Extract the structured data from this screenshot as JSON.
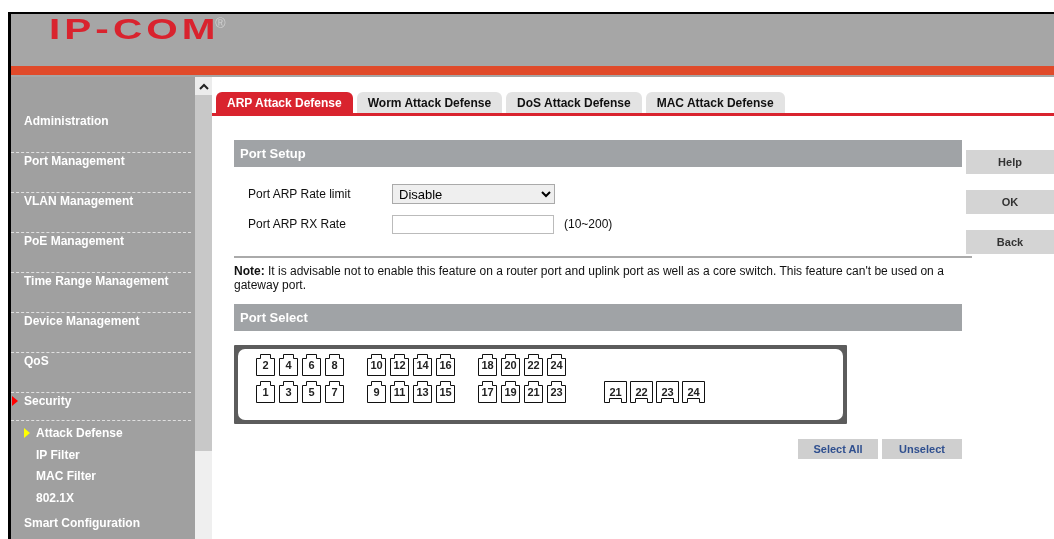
{
  "header": {
    "logo": "IP-COM",
    "logo_mark": "®"
  },
  "sidebar": {
    "items": [
      {
        "label": "Administration",
        "selected": false
      },
      {
        "label": "Port Management",
        "selected": false
      },
      {
        "label": "VLAN Management",
        "selected": false
      },
      {
        "label": "PoE Management",
        "selected": false
      },
      {
        "label": "Time Range Management",
        "selected": false
      },
      {
        "label": "Device Management",
        "selected": false
      },
      {
        "label": "QoS",
        "selected": false
      },
      {
        "label": "Security",
        "selected": true,
        "children": [
          {
            "label": "Attack Defense",
            "selected": true
          },
          {
            "label": "IP Filter",
            "selected": false
          },
          {
            "label": "MAC Filter",
            "selected": false
          },
          {
            "label": "802.1X",
            "selected": false
          }
        ]
      },
      {
        "label": "Smart Configuration",
        "selected": false
      }
    ]
  },
  "tabs": [
    {
      "label": "ARP Attack Defense",
      "selected": true
    },
    {
      "label": "Worm Attack Defense",
      "selected": false
    },
    {
      "label": "DoS Attack Defense",
      "selected": false
    },
    {
      "label": "MAC Attack Defense",
      "selected": false
    }
  ],
  "port_setup": {
    "title": "Port Setup",
    "fields": [
      {
        "kind": "select",
        "label": "Port ARP Rate limit",
        "value": "Disable"
      },
      {
        "kind": "text",
        "label": "Port ARP RX Rate",
        "hint": "(10~200)"
      }
    ]
  },
  "note": "**Note:** It is advisable not to enable this feature on a router port and uplink port as well as a core switch. This feature can't be used on a gateway port.",
  "port_select": {
    "title": "Port Select",
    "rows": [
      [
        {
          "kind": "rj45",
          "groups": [
            [
              "2",
              "4",
              "6",
              "8"
            ],
            [
              "10",
              "12",
              "14",
              "16"
            ],
            [
              "18",
              "20",
              "22",
              "24"
            ]
          ]
        }
      ],
      [
        {
          "kind": "rj45",
          "groups": [
            [
              "1",
              "3",
              "5",
              "7"
            ],
            [
              "9",
              "11",
              "13",
              "15"
            ],
            [
              "17",
              "19",
              "21",
              "23"
            ]
          ]
        },
        {
          "kind": "sfp",
          "groups": [
            [
              "21",
              "22",
              "23",
              "24"
            ]
          ]
        }
      ]
    ],
    "buttons": [
      "Select All",
      "Unselect"
    ]
  },
  "side_buttons": [
    "Help",
    "OK",
    "Back"
  ]
}
